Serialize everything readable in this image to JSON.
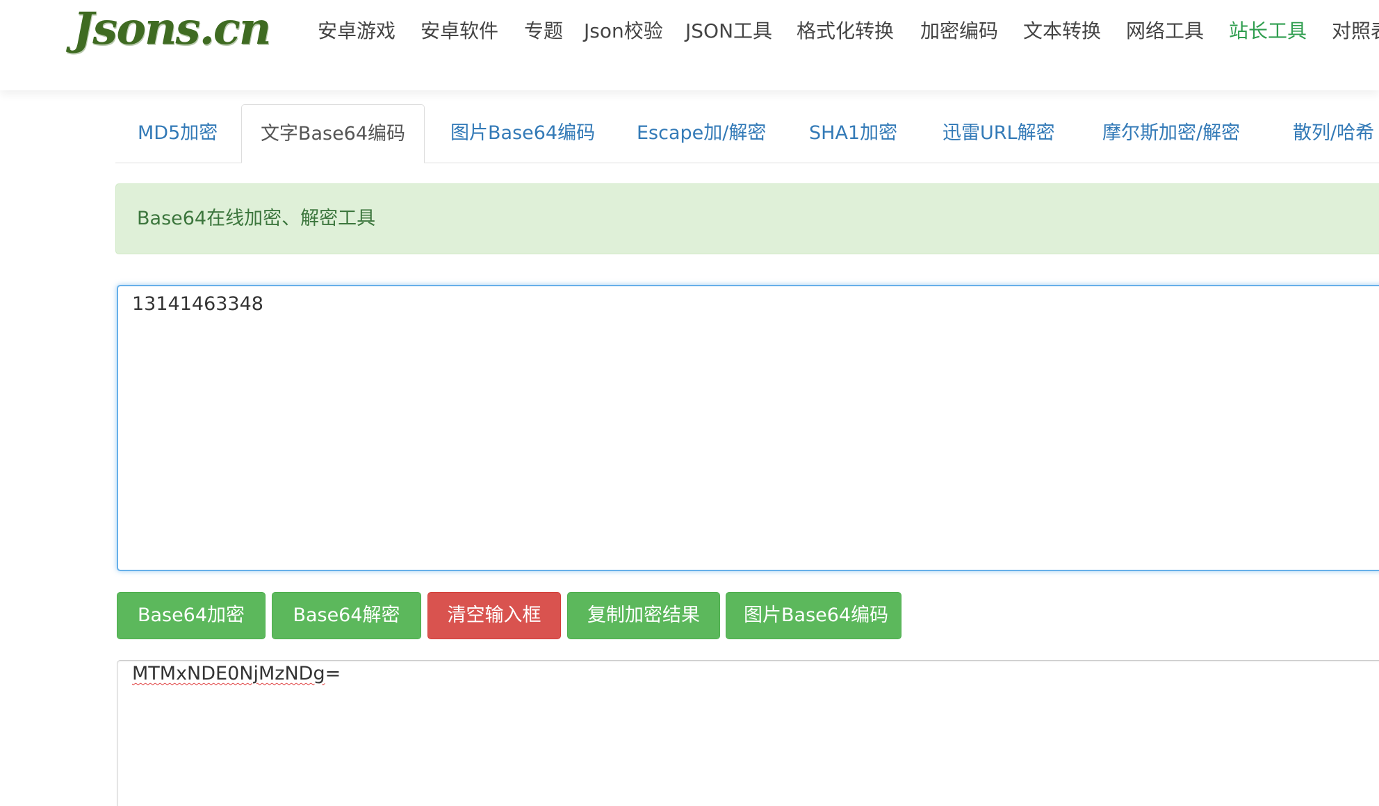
{
  "logo": {
    "text": "Jsons.cn"
  },
  "nav": {
    "items": [
      {
        "label": "安卓游戏"
      },
      {
        "label": "安卓软件"
      },
      {
        "label": "专题"
      },
      {
        "label": "Json校验"
      },
      {
        "label": "JSON工具"
      },
      {
        "label": "格式化转换"
      },
      {
        "label": "加密编码"
      },
      {
        "label": "文本转换"
      },
      {
        "label": "网络工具"
      },
      {
        "label": "站长工具",
        "active": true
      },
      {
        "label": "对照表"
      }
    ]
  },
  "tabs": {
    "items": [
      {
        "label": "MD5加密"
      },
      {
        "label": "文字Base64编码",
        "active": true
      },
      {
        "label": "图片Base64编码"
      },
      {
        "label": "Escape加/解密"
      },
      {
        "label": "SHA1加密"
      },
      {
        "label": "迅雷URL解密"
      },
      {
        "label": "摩尔斯加密/解密"
      },
      {
        "label": "散列/哈希"
      }
    ]
  },
  "alert": {
    "text": "Base64在线加密、解密工具"
  },
  "input": {
    "value": "13141463348"
  },
  "buttons": {
    "encode": "Base64加密",
    "decode": "Base64解密",
    "clear": "清空输入框",
    "copy": "复制加密结果",
    "image": "图片Base64编码"
  },
  "output": {
    "value": "MTMxNDE0NjMzNDg=",
    "value_main": "MTMxNDE0NjMzNDg",
    "value_suffix": "="
  },
  "colors": {
    "logo": "#3f6b22",
    "nav_active": "#2f9e4f",
    "tab_link": "#337ab7",
    "alert_bg": "#dff0d8",
    "alert_text": "#3c763d",
    "btn_success": "#5cb85c",
    "btn_danger": "#d9534f",
    "input_focus": "#66afe9"
  }
}
